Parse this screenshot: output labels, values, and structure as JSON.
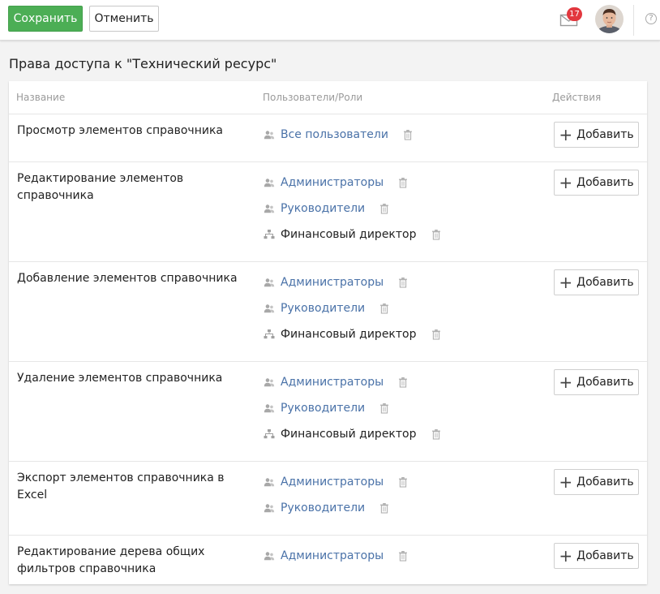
{
  "toolbar": {
    "save_label": "Сохранить",
    "cancel_label": "Отменить",
    "notifications_count": "17",
    "help_label": "?"
  },
  "page": {
    "title": "Права доступа к \"Технический ресурс\""
  },
  "table": {
    "headers": {
      "name": "Название",
      "users": "Пользователи/Роли",
      "actions": "Действия"
    },
    "add_label": "Добавить",
    "rows": [
      {
        "name": "Просмотр элементов справочника",
        "entries": [
          {
            "label": "Все пользователи",
            "kind": "group"
          }
        ]
      },
      {
        "name": "Редактирование элементов справочника",
        "entries": [
          {
            "label": "Администраторы",
            "kind": "group"
          },
          {
            "label": "Руководители",
            "kind": "group"
          },
          {
            "label": "Финансовый директор",
            "kind": "orgunit"
          }
        ]
      },
      {
        "name": "Добавление элементов справочника",
        "entries": [
          {
            "label": "Администраторы",
            "kind": "group"
          },
          {
            "label": "Руководители",
            "kind": "group"
          },
          {
            "label": "Финансовый директор",
            "kind": "orgunit"
          }
        ]
      },
      {
        "name": "Удаление элементов справочника",
        "entries": [
          {
            "label": "Администраторы",
            "kind": "group"
          },
          {
            "label": "Руководители",
            "kind": "group"
          },
          {
            "label": "Финансовый директор",
            "kind": "orgunit"
          }
        ]
      },
      {
        "name": "Экспорт элементов справочника в Excel",
        "entries": [
          {
            "label": "Администраторы",
            "kind": "group"
          },
          {
            "label": "Руководители",
            "kind": "group"
          }
        ]
      },
      {
        "name": "Редактирование дерева общих фильтров справочника",
        "entries": [
          {
            "label": "Администраторы",
            "kind": "group"
          }
        ]
      }
    ]
  },
  "colors": {
    "primary": "#4cae55",
    "link": "#4a72a8",
    "badge": "#e2383f"
  },
  "icons": {
    "group": "users-icon",
    "orgunit": "org-structure-icon",
    "delete": "trash-icon",
    "add": "plus-icon"
  }
}
